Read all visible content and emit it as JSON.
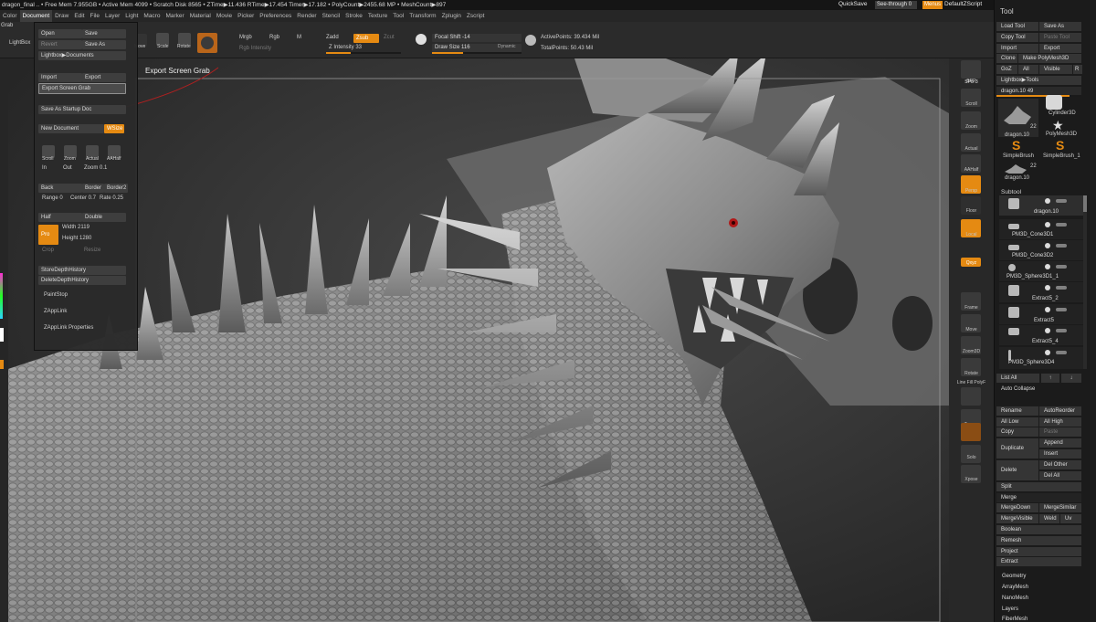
{
  "titlebar": {
    "text": "dragon_final  .. • Free Mem 7.955GB • Active Mem 4099 • Scratch Disk 8565 • ZTime▶11.436 RTime▶17.454 Timer▶17.182 • PolyCount▶2455.68 MP • MeshCount▶897",
    "quicksave": "QuickSave",
    "seethrough": "See-through  0",
    "menus": "Menus",
    "defaultzscript": "DefaultZScript"
  },
  "menubar": [
    "Color",
    "Document",
    "Draw",
    "Edit",
    "File",
    "Layer",
    "Light",
    "Macro",
    "Marker",
    "Material",
    "Movie",
    "Picker",
    "Preferences",
    "Render",
    "Stencil",
    "Stroke",
    "Texture",
    "Tool",
    "Transform",
    "Zplugin",
    "Zscript"
  ],
  "topbar": {
    "grab": "Grab",
    "lightbox": "LightBox",
    "move": "Move",
    "scale": "Scale",
    "rotate": "Rotate",
    "mrgb": "Mrgb",
    "rgb": "Rgb",
    "m": "M",
    "zadd": "Zadd",
    "zsub": "Zsub",
    "zcut": "Zcut",
    "rgb_intensity": "Rgb Intensity",
    "z_intensity": "Z Intensity 33",
    "focal_shift": "Focal Shift -14",
    "draw_size": "Draw Size 116",
    "dynamic": "Dynamic",
    "active_points": "ActivePoints: 39.434 Mil",
    "total_points": "TotalPoints: 50.43 Mil",
    "z_intensity_value": 0.33,
    "draw_size_value": 0.35
  },
  "docmenu": {
    "open": "Open",
    "save": "Save",
    "revert": "Revert",
    "save_as": "Save As",
    "lightbox_documents": "Lightbox▶Documents",
    "import": "Import",
    "export": "Export",
    "export_screen_grab": "Export Screen Grab",
    "save_startup": "Save As Startup Doc",
    "new_document": "New Document",
    "wsize": "WSize",
    "scroll": "Scroll",
    "zoom": "Zoom",
    "actual": "Actual",
    "aahalf": "AAHalf",
    "in": "In",
    "out": "Out",
    "zoom_val": "Zoom 0.1",
    "back": "Back",
    "border": "Border",
    "border2": "Border2",
    "range": "Range 0",
    "center": "Center 0.7",
    "rate": "Rate 0.25",
    "half": "Half",
    "double": "Double",
    "pro": "Pro",
    "width": "Width 2119",
    "height": "Height 1280",
    "crop": "Crop",
    "resize": "Resize",
    "store_depth": "StoreDepthHistory",
    "delete_depth": "DeleteDepthHistory",
    "paintstop": "PaintStop",
    "zapplink": "ZAppLink",
    "zapplink_props": "ZAppLink Properties"
  },
  "viewport": {
    "tooltip": "Export Screen Grab"
  },
  "rightshelf": [
    "BPR",
    "SPix 3",
    "Scroll",
    "Zoom",
    "Actual",
    "AAHalf",
    "Persp",
    "Floor",
    "Local",
    "Qxyz",
    "Frame",
    "Move",
    "Zoom3D",
    "Rotate",
    "Line Fill PolyF",
    "Transp",
    "Ghost",
    "Solo",
    "Xpose"
  ],
  "toolpanel": {
    "title": "Tool",
    "load_tool": "Load Tool",
    "save_as": "Save As",
    "copy_tool": "Copy Tool",
    "paste_tool": "Paste Tool",
    "import": "Import",
    "export": "Export",
    "clone": "Clone",
    "make_polymesh": "Make PolyMesh3D",
    "goz": "GoZ",
    "all": "All",
    "visible": "Visible",
    "r": "R",
    "lightbox_tools": "Lightbox▶Tools",
    "dragon_slider": "dragon.10 49",
    "thumbs": [
      {
        "label": "dragon.10",
        "count": "22"
      },
      {
        "label": "Cylinder3D",
        "count": ""
      },
      {
        "label": "PolyMesh3D",
        "count": ""
      },
      {
        "label": "SimpleBrush",
        "count": ""
      },
      {
        "label": "SimpleBrush_1",
        "count": ""
      },
      {
        "label": "dragon.10",
        "count": "22"
      }
    ],
    "subtool": "Subtool",
    "subtools": [
      "dragon.10",
      "PM3D_Cone3D1",
      "PM3D_Cone3D2",
      "PM3D_Sphere3D1_1",
      "Extract5_2",
      "Extract5",
      "Extract5_4",
      "PM3D_Sphere3D4"
    ],
    "list_all": "List All",
    "auto_collapse": "Auto Collapse",
    "rename": "Rename",
    "autoreorder": "AutoReorder",
    "all_low": "All Low",
    "all_high": "All High",
    "copy": "Copy",
    "paste": "Paste",
    "duplicate": "Duplicate",
    "append": "Append",
    "insert": "Insert",
    "delete": "Delete",
    "del_other": "Del Other",
    "del_all": "Del All",
    "split": "Split",
    "merge": "Merge",
    "merge_down": "MergeDown",
    "merge_similar": "MergeSimilar",
    "merge_visible": "MergeVisible",
    "weld": "Weld",
    "uv": "Uv",
    "boolean": "Boolean",
    "remesh": "Remesh",
    "project": "Project",
    "extract": "Extract",
    "geometry": "Geometry",
    "arraymesh": "ArrayMesh",
    "nanomesh": "NanoMesh",
    "layers": "Layers",
    "fibermesh": "FiberMesh"
  },
  "colors": {
    "accent": "#e58a12",
    "panel": "#2b2b2b",
    "dark": "#1b1b1b"
  }
}
